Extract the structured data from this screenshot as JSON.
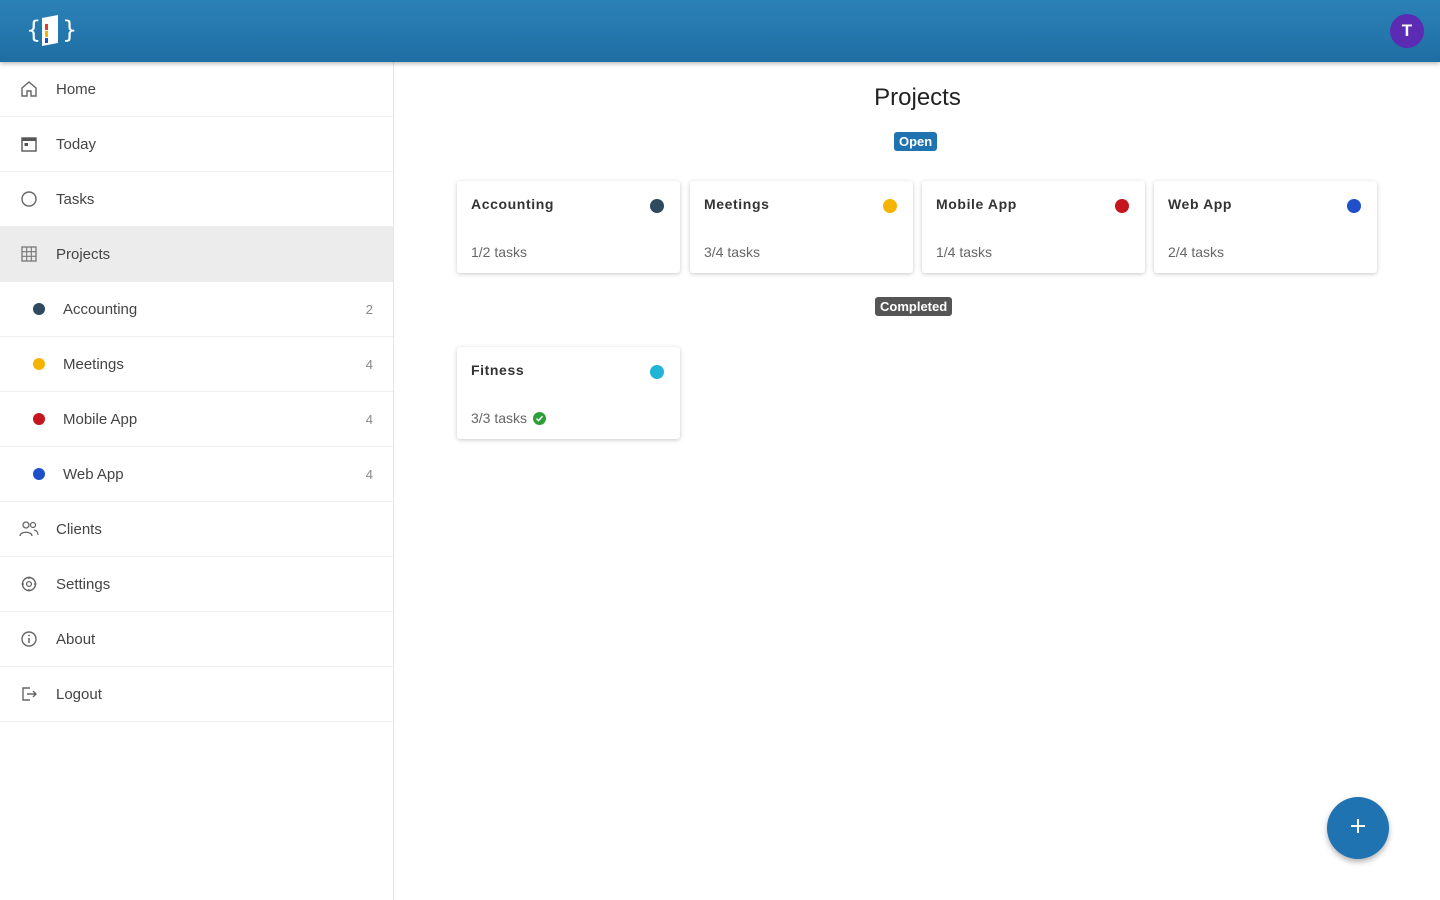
{
  "header": {
    "avatar_initial": "T",
    "avatar_color": "#5b2bb3",
    "bar_color": "#2278b0"
  },
  "sidebar": {
    "items": [
      {
        "label": "Home",
        "icon": "home-icon"
      },
      {
        "label": "Today",
        "icon": "calendar-today-icon"
      },
      {
        "label": "Tasks",
        "icon": "circle-icon"
      },
      {
        "label": "Projects",
        "icon": "grid-icon"
      },
      {
        "label": "Clients",
        "icon": "people-icon"
      },
      {
        "label": "Settings",
        "icon": "settings-icon"
      },
      {
        "label": "About",
        "icon": "info-icon"
      },
      {
        "label": "Logout",
        "icon": "logout-icon"
      }
    ],
    "projects": [
      {
        "label": "Accounting",
        "count": "2",
        "color": "#2d4a5e"
      },
      {
        "label": "Meetings",
        "count": "4",
        "color": "#f5b400"
      },
      {
        "label": "Mobile App",
        "count": "4",
        "color": "#c4161c"
      },
      {
        "label": "Web App",
        "count": "4",
        "color": "#1f4fc9"
      }
    ]
  },
  "main": {
    "title": "Projects",
    "open_label": "Open",
    "completed_label": "Completed",
    "open_projects": [
      {
        "name": "Accounting",
        "tasks": "1/2 tasks",
        "color": "#2d4a5e"
      },
      {
        "name": "Meetings",
        "tasks": "3/4 tasks",
        "color": "#f5b400"
      },
      {
        "name": "Mobile App",
        "tasks": "1/4 tasks",
        "color": "#c4161c"
      },
      {
        "name": "Web App",
        "tasks": "2/4 tasks",
        "color": "#1f4fc9"
      }
    ],
    "completed_projects": [
      {
        "name": "Fitness",
        "tasks": "3/3 tasks",
        "color": "#1fb5d6"
      }
    ]
  },
  "fab": {
    "icon": "plus-icon"
  }
}
